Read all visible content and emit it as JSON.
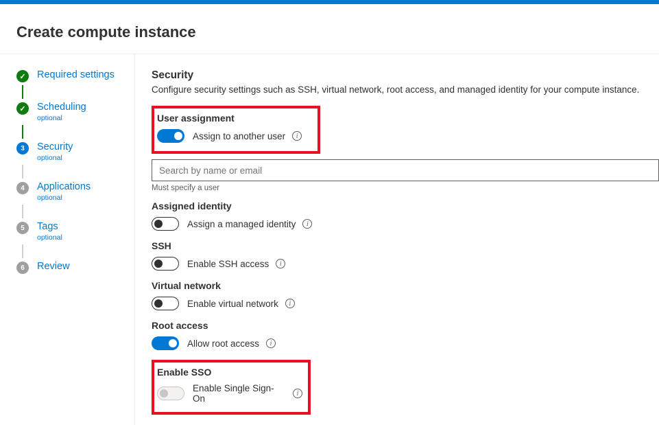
{
  "header": {
    "title": "Create compute instance"
  },
  "sidebar": {
    "steps": [
      {
        "label": "Required settings",
        "sub": "",
        "state": "done"
      },
      {
        "label": "Scheduling",
        "sub": "optional",
        "state": "done"
      },
      {
        "label": "Security",
        "sub": "optional",
        "state": "current"
      },
      {
        "label": "Applications",
        "sub": "optional",
        "state": "pending"
      },
      {
        "label": "Tags",
        "sub": "optional",
        "state": "pending"
      },
      {
        "label": "Review",
        "sub": "",
        "state": "pending"
      }
    ]
  },
  "main": {
    "title": "Security",
    "desc": "Configure security settings such as SSH, virtual network, root access, and managed identity for your compute instance.",
    "user_assignment": {
      "title": "User assignment",
      "toggle_label": "Assign to another user",
      "search_placeholder": "Search by name or email",
      "hint": "Must specify a user"
    },
    "assigned_identity": {
      "title": "Assigned identity",
      "toggle_label": "Assign a managed identity"
    },
    "ssh": {
      "title": "SSH",
      "toggle_label": "Enable SSH access"
    },
    "vnet": {
      "title": "Virtual network",
      "toggle_label": "Enable virtual network"
    },
    "root": {
      "title": "Root access",
      "toggle_label": "Allow root access"
    },
    "sso": {
      "title": "Enable SSO",
      "toggle_label": "Enable Single Sign-On"
    }
  }
}
